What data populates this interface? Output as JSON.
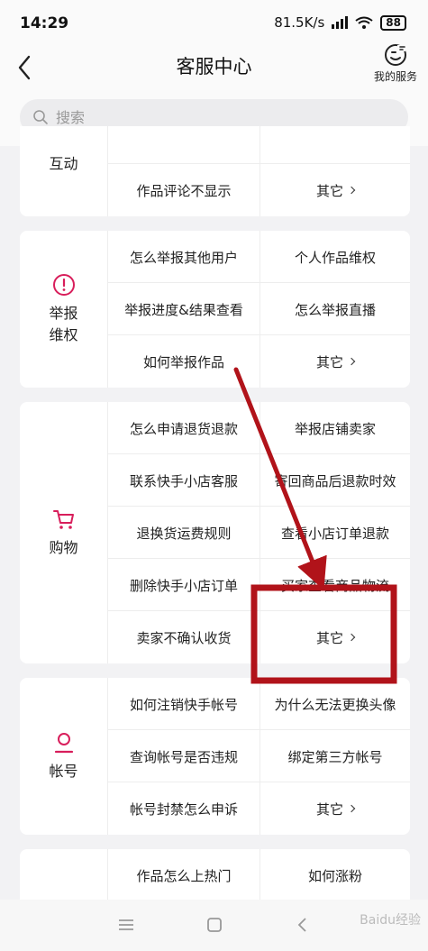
{
  "status_bar": {
    "time": "14:29",
    "net_speed": "81.5K/s",
    "battery": "88"
  },
  "header": {
    "title": "客服中心",
    "my_service_label": "我的服务"
  },
  "search": {
    "placeholder": "搜索"
  },
  "sections": [
    {
      "label": "互动",
      "rows": [
        [
          "",
          ""
        ],
        [
          "作品评论不显示",
          "其它"
        ]
      ]
    },
    {
      "label": "举报维权",
      "icon": "alert-circle-icon",
      "rows": [
        [
          "怎么举报其他用户",
          "个人作品维权"
        ],
        [
          "举报进度&结果查看",
          "怎么举报直播"
        ],
        [
          "如何举报作品",
          "其它"
        ]
      ]
    },
    {
      "label": "购物",
      "icon": "shopping-cart-icon",
      "rows": [
        [
          "怎么申请退货退款",
          "举报店铺卖家"
        ],
        [
          "联系快手小店客服",
          "寄回商品后退款时效"
        ],
        [
          "退换货运费规则",
          "查看小店订单退款"
        ],
        [
          "删除快手小店订单",
          "买家查看商品物流"
        ],
        [
          "卖家不确认收货",
          "其它"
        ]
      ]
    },
    {
      "label": "帐号",
      "icon": "user-icon",
      "rows": [
        [
          "如何注销快手帐号",
          "为什么无法更换头像"
        ],
        [
          "查询帐号是否违规",
          "绑定第三方帐号"
        ],
        [
          "帐号封禁怎么申诉",
          "其它"
        ]
      ]
    },
    {
      "label": "",
      "rows": [
        [
          "作品怎么上热门",
          "如何涨粉"
        ]
      ]
    }
  ],
  "colors": {
    "accent": "#d81e5b",
    "annotation": "#b1131a"
  },
  "watermark": "Baidu经验"
}
